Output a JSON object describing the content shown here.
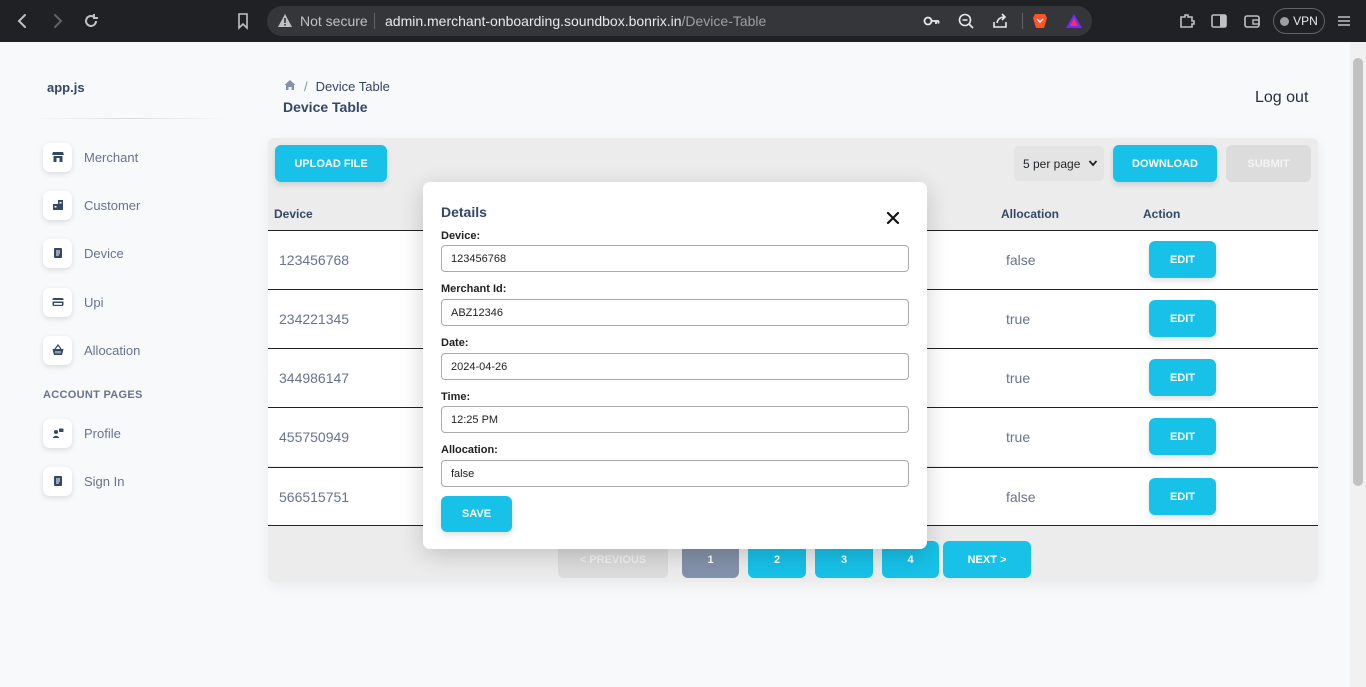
{
  "browser": {
    "security_label": "Not secure",
    "url_host": "admin.merchant-onboarding.soundbox.bonrix.in",
    "url_path": "/Device-Table",
    "vpn_label": "VPN"
  },
  "sidebar": {
    "brand": "app.js",
    "items": [
      {
        "label": "Merchant",
        "icon": "shop-icon"
      },
      {
        "label": "Customer",
        "icon": "office-icon"
      },
      {
        "label": "Device",
        "icon": "document-icon"
      },
      {
        "label": "Upi",
        "icon": "credit-card-icon"
      },
      {
        "label": "Allocation",
        "icon": "basket-icon"
      }
    ],
    "section_heading": "ACCOUNT PAGES",
    "account_items": [
      {
        "label": "Profile",
        "icon": "customer-support-icon"
      },
      {
        "label": "Sign In",
        "icon": "document-icon"
      }
    ]
  },
  "header": {
    "breadcrumb_current": "Device Table",
    "title": "Device Table",
    "logout": "Log out"
  },
  "toolbar": {
    "upload": "UPLOAD FILE",
    "per_page": "5 per page",
    "download": "DOWNLOAD",
    "submit": "SUBMIT"
  },
  "table": {
    "columns": {
      "device": "Device",
      "allocation": "Allocation",
      "action": "Action"
    },
    "rows": [
      {
        "device": "123456768",
        "allocation": "false",
        "action": "EDIT"
      },
      {
        "device": "234221345",
        "allocation": "true",
        "action": "EDIT"
      },
      {
        "device": "344986147",
        "allocation": "true",
        "action": "EDIT"
      },
      {
        "device": "455750949",
        "allocation": "true",
        "action": "EDIT"
      },
      {
        "device": "566515751",
        "allocation": "false",
        "action": "EDIT"
      }
    ]
  },
  "pagination": {
    "previous": "< PREVIOUS",
    "pages": [
      "1",
      "2",
      "3",
      "4"
    ],
    "current_page": "1",
    "next": "NEXT >"
  },
  "modal": {
    "title": "Details",
    "fields": [
      {
        "label": "Device:",
        "value": "123456768"
      },
      {
        "label": "Merchant Id:",
        "value": "ABZ12346"
      },
      {
        "label": "Date:",
        "value": "2024-04-26"
      },
      {
        "label": "Time:",
        "value": "12:25 PM"
      },
      {
        "label": "Allocation:",
        "value": "false"
      }
    ],
    "save": "SAVE"
  },
  "colors": {
    "accent": "#17c1e8",
    "text": "#344767",
    "muted": "#67748e",
    "active_page": "#8392ab"
  }
}
